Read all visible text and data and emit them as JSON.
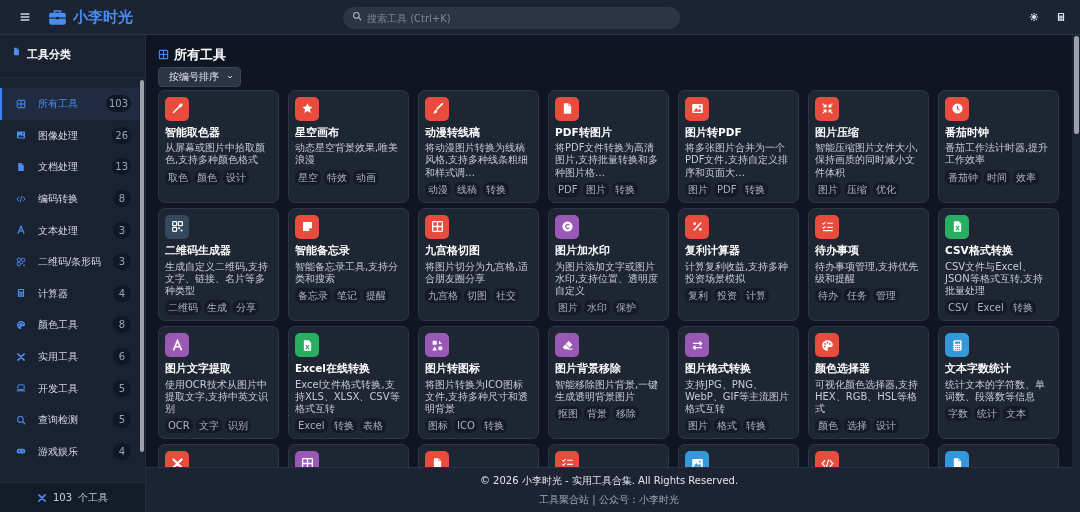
{
  "header": {
    "brand": "小李时光",
    "search": {
      "placeholder": "搜索工具 (Ctrl+K)"
    }
  },
  "sidebar": {
    "title": "工具分类",
    "items": [
      {
        "label": "所有工具",
        "count": "103",
        "selected": true
      },
      {
        "label": "图像处理",
        "count": "26",
        "selected": false
      },
      {
        "label": "文档处理",
        "count": "13",
        "selected": false
      },
      {
        "label": "编码转换",
        "count": "8",
        "selected": false
      },
      {
        "label": "文本处理",
        "count": "3",
        "selected": false
      },
      {
        "label": "二维码/条形码",
        "count": "3",
        "selected": false
      },
      {
        "label": "计算器",
        "count": "4",
        "selected": false
      },
      {
        "label": "颜色工具",
        "count": "8",
        "selected": false
      },
      {
        "label": "实用工具",
        "count": "6",
        "selected": false
      },
      {
        "label": "开发工具",
        "count": "5",
        "selected": false
      },
      {
        "label": "查询检测",
        "count": "5",
        "selected": false
      },
      {
        "label": "游戏娱乐",
        "count": "4",
        "selected": false
      }
    ],
    "footer": {
      "count": "103",
      "label": "个工具"
    }
  },
  "main": {
    "title": "所有工具",
    "sort": {
      "value": "按编号排序"
    },
    "tools": [
      {
        "name": "智能取色器",
        "description": "从屏幕或图片中拾取颜色,支持多种颜色格式",
        "tags": [
          "取色",
          "颜色",
          "设计"
        ],
        "color": "#e74c3c"
      },
      {
        "name": "星空画布",
        "description": "动态星空背景效果,唯美浪漫",
        "tags": [
          "星空",
          "特效",
          "动画"
        ],
        "color": "#e74c3c"
      },
      {
        "name": "动漫转线稿",
        "description": "将动漫图片转换为线稿风格,支持多种线条粗细和样式调…",
        "tags": [
          "动漫",
          "线稿",
          "转换"
        ],
        "color": "#e74c3c"
      },
      {
        "name": "PDF转图片",
        "description": "将PDF文件转换为高清图片,支持批量转换和多种图片格…",
        "tags": [
          "PDF",
          "图片",
          "转换"
        ],
        "color": "#e74c3c"
      },
      {
        "name": "图片转PDF",
        "description": "将多张图片合并为一个PDF文件,支持自定义排序和页面大…",
        "tags": [
          "图片",
          "PDF",
          "转换"
        ],
        "color": "#e74c3c"
      },
      {
        "name": "图片压缩",
        "description": "智能压缩图片文件大小,保持画质的同时减小文件体积",
        "tags": [
          "图片",
          "压缩",
          "优化"
        ],
        "color": "#e74c3c"
      },
      {
        "name": "番茄时钟",
        "description": "番茄工作法计时器,提升工作效率",
        "tags": [
          "番茄钟",
          "时间",
          "效率"
        ],
        "color": "#e74c3c"
      },
      {
        "name": "二维码生成器",
        "description": "生成自定义二维码,支持文字、链接、名片等多种类型",
        "tags": [
          "二维码",
          "生成",
          "分享"
        ],
        "color": "#34495e"
      },
      {
        "name": "智能备忘录",
        "description": "智能备忘录工具,支持分类和搜索",
        "tags": [
          "备忘录",
          "笔记",
          "提醒"
        ],
        "color": "#e74c3c"
      },
      {
        "name": "九宫格切图",
        "description": "将图片切分为九宫格,适合朋友圈分享",
        "tags": [
          "九宫格",
          "切图",
          "社交"
        ],
        "color": "#e74c3c"
      },
      {
        "name": "图片加水印",
        "description": "为图片添加文字或图片水印,支持位置、透明度自定义",
        "tags": [
          "图片",
          "水印",
          "保护"
        ],
        "color": "#9b59b6"
      },
      {
        "name": "复利计算器",
        "description": "计算复利收益,支持多种投资场景模拟",
        "tags": [
          "复利",
          "投资",
          "计算"
        ],
        "color": "#e74c3c"
      },
      {
        "name": "待办事项",
        "description": "待办事项管理,支持优先级和提醒",
        "tags": [
          "待办",
          "任务",
          "管理"
        ],
        "color": "#e74c3c"
      },
      {
        "name": "CSV格式转换",
        "description": "CSV文件与Excel、JSON等格式互转,支持批量处理",
        "tags": [
          "CSV",
          "Excel",
          "转换"
        ],
        "color": "#27ae60"
      },
      {
        "name": "图片文字提取",
        "description": "使用OCR技术从图片中提取文字,支持中英文识别",
        "tags": [
          "OCR",
          "文字",
          "识别"
        ],
        "color": "#9b59b6"
      },
      {
        "name": "Excel在线转换",
        "description": "Excel文件格式转换,支持XLS、XLSX、CSV等格式互转",
        "tags": [
          "Excel",
          "转换",
          "表格"
        ],
        "color": "#27ae60"
      },
      {
        "name": "图片转图标",
        "description": "将图片转换为ICO图标文件,支持多种尺寸和透明背景",
        "tags": [
          "图标",
          "ICO",
          "转换"
        ],
        "color": "#9b59b6"
      },
      {
        "name": "图片背景移除",
        "description": "智能移除图片背景,一键生成透明背景图片",
        "tags": [
          "抠图",
          "背景",
          "移除"
        ],
        "color": "#9b59b6"
      },
      {
        "name": "图片格式转换",
        "description": "支持JPG、PNG、WebP、GIF等主流图片格式互转",
        "tags": [
          "图片",
          "格式",
          "转换"
        ],
        "color": "#9b59b6"
      },
      {
        "name": "颜色选择器",
        "description": "可视化颜色选择器,支持HEX、RGB、HSL等格式",
        "tags": [
          "颜色",
          "选择",
          "设计"
        ],
        "color": "#e74c3c"
      },
      {
        "name": "文本字数统计",
        "description": "统计文本的字符数、单词数、段落数等信息",
        "tags": [
          "字数",
          "统计",
          "文本"
        ],
        "color": "#3498db"
      }
    ],
    "more_tools": [
      {
        "color": "#e74c3c"
      },
      {
        "color": "#9b59b6"
      },
      {
        "color": "#e74c3c"
      },
      {
        "color": "#e74c3c"
      },
      {
        "color": "#3498db"
      },
      {
        "color": "#e74c3c"
      },
      {
        "color": "#3498db"
      }
    ]
  },
  "footer": {
    "copyright": "© 2026 小李时光 - 实用工具合集. All Rights Reserved.",
    "links": "工具聚合站 | 公众号：小李时光"
  }
}
